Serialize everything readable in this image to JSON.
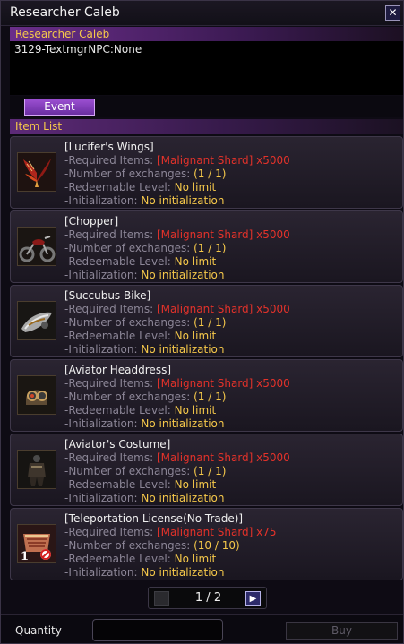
{
  "window": {
    "title": "Researcher Caleb"
  },
  "npc": {
    "name": "Researcher Caleb",
    "dialog": "3129-TextmgrNPC:None"
  },
  "tabs": [
    {
      "label": "Event"
    }
  ],
  "list": {
    "header": "Item List",
    "labels": {
      "required": "-Required Items:",
      "exchanges": "-Number of exchanges:",
      "level": "-Redeemable Level:",
      "init": "-Initialization:"
    },
    "items": [
      {
        "name": "[Lucifer's Wings]",
        "icon": "wings-icon",
        "required": "[Malignant Shard] x5000",
        "exchanges": "(1 / 1)",
        "level": "No limit",
        "init": "No initialization"
      },
      {
        "name": "[Chopper]",
        "icon": "motorcycle-icon",
        "required": "[Malignant Shard] x5000",
        "exchanges": "(1 / 1)",
        "level": "No limit",
        "init": "No initialization"
      },
      {
        "name": "[Succubus Bike]",
        "icon": "bike-icon",
        "required": "[Malignant Shard] x5000",
        "exchanges": "(1 / 1)",
        "level": "No limit",
        "init": "No initialization"
      },
      {
        "name": "[Aviator Headdress]",
        "icon": "helmet-icon",
        "required": "[Malignant Shard] x5000",
        "exchanges": "(1 / 1)",
        "level": "No limit",
        "init": "No initialization"
      },
      {
        "name": "[Aviator's Costume]",
        "icon": "costume-icon",
        "required": "[Malignant Shard] x5000",
        "exchanges": "(1 / 1)",
        "level": "No limit",
        "init": "No initialization"
      },
      {
        "name": "[Teleportation License(No Trade)]",
        "icon": "license-icon",
        "icon_count": "1",
        "required": "[Malignant Shard] x75",
        "exchanges": "(10 / 10)",
        "level": "No limit",
        "init": "No initialization"
      }
    ]
  },
  "pager": {
    "text": "1 / 2"
  },
  "footer": {
    "quantity_label": "Quantity",
    "quantity_value": "",
    "buy_label": "Buy"
  },
  "colors": {
    "accent_purple": "#6a2e8a",
    "label_gold": "#f5c84a",
    "required_red": "#e3322a",
    "label_grey": "#8c8697"
  }
}
